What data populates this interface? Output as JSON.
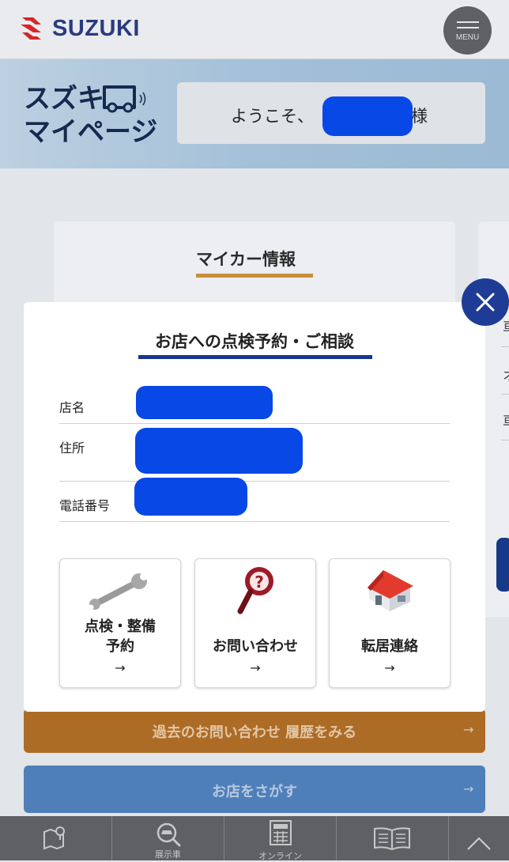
{
  "header": {
    "brand": "SUZUKI",
    "menu_label": "MENU"
  },
  "banner": {
    "mypage_line1": "スズキ",
    "mypage_line2": "マイページ",
    "welcome_prefix": "ようこそ、",
    "welcome_suffix": "様"
  },
  "background_card": {
    "title": "マイカー情報",
    "right_peek_chars": [
      "車",
      "オ",
      "車"
    ]
  },
  "modal": {
    "title": "お店への点検予約・ご相談",
    "rows": [
      {
        "label": "店名"
      },
      {
        "label": "住所"
      },
      {
        "label": "電話番号"
      }
    ],
    "tiles": [
      {
        "line1": "点検・整備",
        "line2": "予約",
        "arrow": "→",
        "icon": "wrench-icon"
      },
      {
        "line1": "お問い合わせ",
        "line2": "",
        "arrow": "→",
        "icon": "magnifier-icon"
      },
      {
        "line1": "転居連絡",
        "line2": "",
        "arrow": "→",
        "icon": "house-icon"
      }
    ]
  },
  "buttons": {
    "history": "過去のお問い合わせ 履歴をみる",
    "find_store": "お店をさがす",
    "arrow": "→"
  },
  "bottom_nav": [
    {
      "icon": "map-pin-icon",
      "label": ""
    },
    {
      "icon": "car-search-icon",
      "label": "展示車"
    },
    {
      "icon": "calculator-icon",
      "label": "オンライン"
    },
    {
      "icon": "book-icon",
      "label": ""
    },
    {
      "icon": "chevron-up-icon",
      "label": ""
    }
  ],
  "colors": {
    "brand_blue": "#2a3b7f",
    "brand_red": "#d7262a",
    "redaction": "#0848e6",
    "orange": "#ad6c26",
    "accent_blue": "#1e3c96"
  }
}
